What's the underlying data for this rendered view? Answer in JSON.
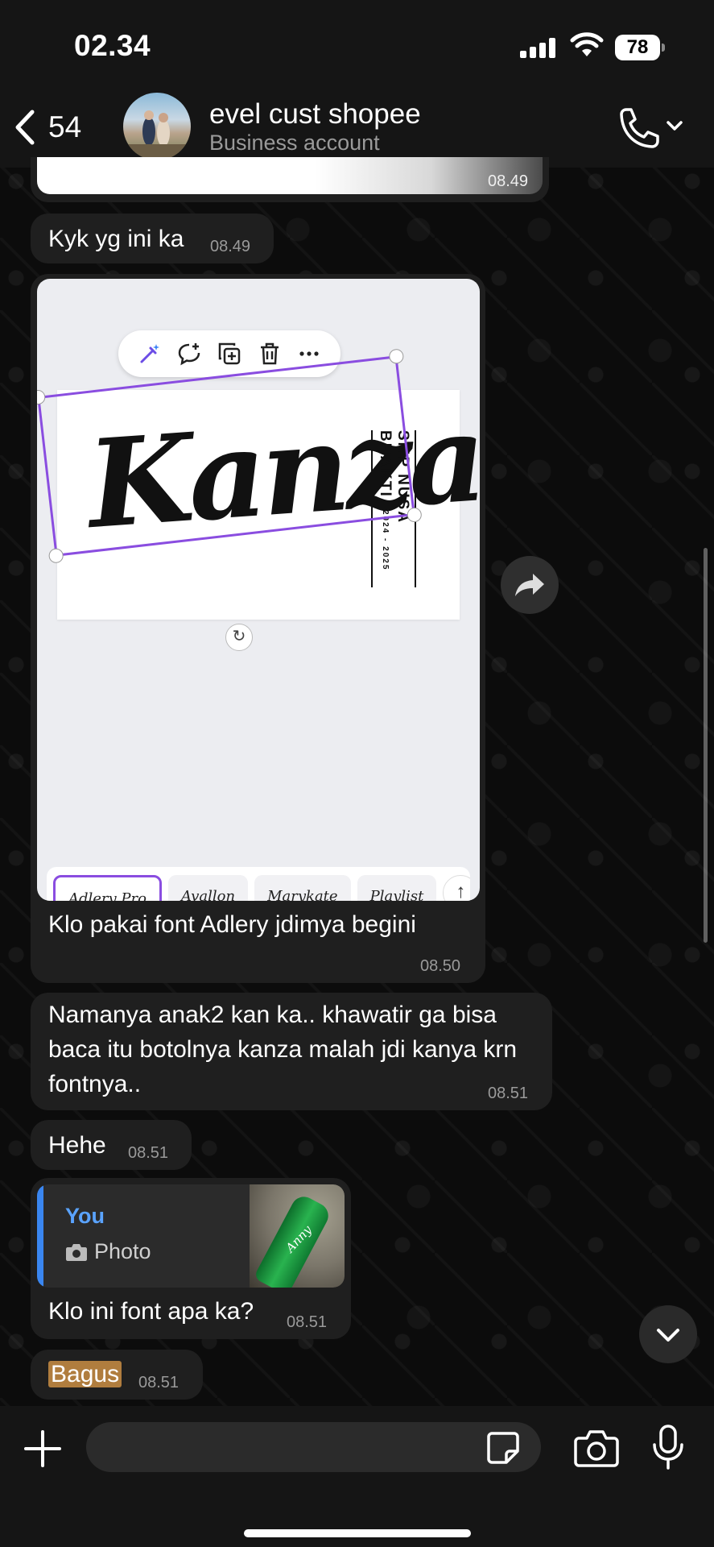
{
  "status_bar": {
    "time": "02.34",
    "battery": "78"
  },
  "header": {
    "back_count": "54",
    "contact_name": "evel cust shopee",
    "contact_subtitle": "Business account"
  },
  "messages": [
    {
      "type": "image",
      "time": "08.49"
    },
    {
      "type": "text",
      "text": "Kyk yg ini ka",
      "time": "08.49"
    },
    {
      "type": "image_with_caption",
      "caption": "Klo pakai font Adlery jdimya begini",
      "time": "08.50",
      "image": {
        "design_text": "Kanza",
        "side_text": "SMP NUSA BHAKTI",
        "side_text_years": "2024 - 2025",
        "font_options": [
          "Adlery Pro",
          "Avallon",
          "Marykate",
          "Playlist"
        ]
      }
    },
    {
      "type": "text",
      "text": "Namanya anak2 kan ka.. khawatir ga bisa baca itu botolnya kanza malah jdi kanya krn fontnya..",
      "time": "08.51"
    },
    {
      "type": "text",
      "text": "Hehe",
      "time": "08.51"
    },
    {
      "type": "reply",
      "quote_author": "You",
      "quote_type": "Photo",
      "quote_thumb_text": "Anny",
      "text": "Klo ini font apa ka?",
      "time": "08.51"
    },
    {
      "type": "text",
      "text": "Bagus",
      "time": "08.51",
      "highlighted": true
    }
  ],
  "composer": {
    "placeholder": ""
  },
  "icons": {
    "back": "chevron-left-icon",
    "call": "phone-icon",
    "forward": "forward-icon",
    "scroll_down": "chevron-down-icon",
    "plus": "plus-icon",
    "sticker": "sticker-icon",
    "camera": "camera-icon",
    "mic": "mic-icon"
  },
  "colors": {
    "bubble": "#1f1f1f",
    "reply_accent": "#3a86f0",
    "selection": "#8a4de0",
    "highlight": "#b07d3e"
  }
}
